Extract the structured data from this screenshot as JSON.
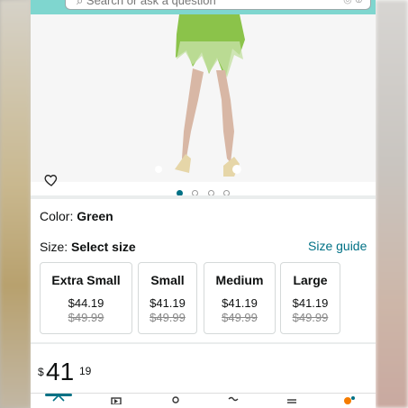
{
  "search": {
    "placeholder": "Search or ask a question"
  },
  "product": {
    "color_label": "Color:",
    "color_value": "Green",
    "size_label": "Size:",
    "size_value": "Select size",
    "size_guide": "Size guide",
    "image_pagination": {
      "count": 4,
      "active_index": 0
    }
  },
  "sizes": [
    {
      "name": "Extra Small",
      "price": "$44.19",
      "old_price": "$49.99"
    },
    {
      "name": "Small",
      "price": "$41.19",
      "old_price": "$49.99"
    },
    {
      "name": "Medium",
      "price": "$41.19",
      "old_price": "$49.99"
    },
    {
      "name": "Large",
      "price": "$41.19",
      "old_price": "$49.99"
    }
  ],
  "price": {
    "currency": "$",
    "whole": "41",
    "cents": "19"
  },
  "bottom_nav": {
    "items": [
      {
        "icon": "home-icon"
      },
      {
        "icon": "video-icon"
      },
      {
        "icon": "profile-icon"
      },
      {
        "icon": "more-icon"
      },
      {
        "icon": "menu-icon"
      },
      {
        "icon": "cart-icon"
      }
    ],
    "active_index": 0
  },
  "colors": {
    "accent": "#007185",
    "topbar": "#7fd6cf",
    "dress_green": "#8bc34a"
  }
}
